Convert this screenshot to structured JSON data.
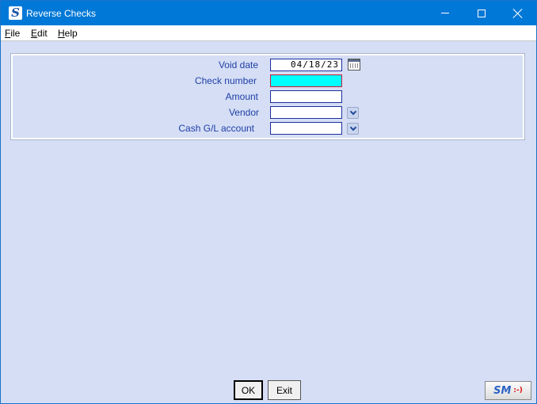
{
  "window": {
    "title": "Reverse Checks"
  },
  "menu": [
    {
      "label": "File"
    },
    {
      "label": "Edit"
    },
    {
      "label": "Help"
    }
  ],
  "form": {
    "void_date": {
      "label": "Void date",
      "value": "04/18/23"
    },
    "check_number": {
      "label": "Check number",
      "value": ""
    },
    "amount": {
      "label": "Amount",
      "value": ""
    },
    "vendor": {
      "label": "Vendor",
      "value": ""
    },
    "cash_gl_account": {
      "label": "Cash G/L account",
      "value": ""
    }
  },
  "buttons": {
    "ok": "OK",
    "exit": "Exit"
  },
  "branding": {
    "logo": "SM",
    "smile": ":-)"
  },
  "colors": {
    "titlebar": "#0078d7",
    "background": "#d5def5",
    "label": "#1f3fa6",
    "active_field": "#00ffff"
  },
  "icons": [
    "app-logo-icon",
    "minimize-icon",
    "maximize-icon",
    "close-icon",
    "calendar-icon",
    "chevron-down-icon"
  ]
}
